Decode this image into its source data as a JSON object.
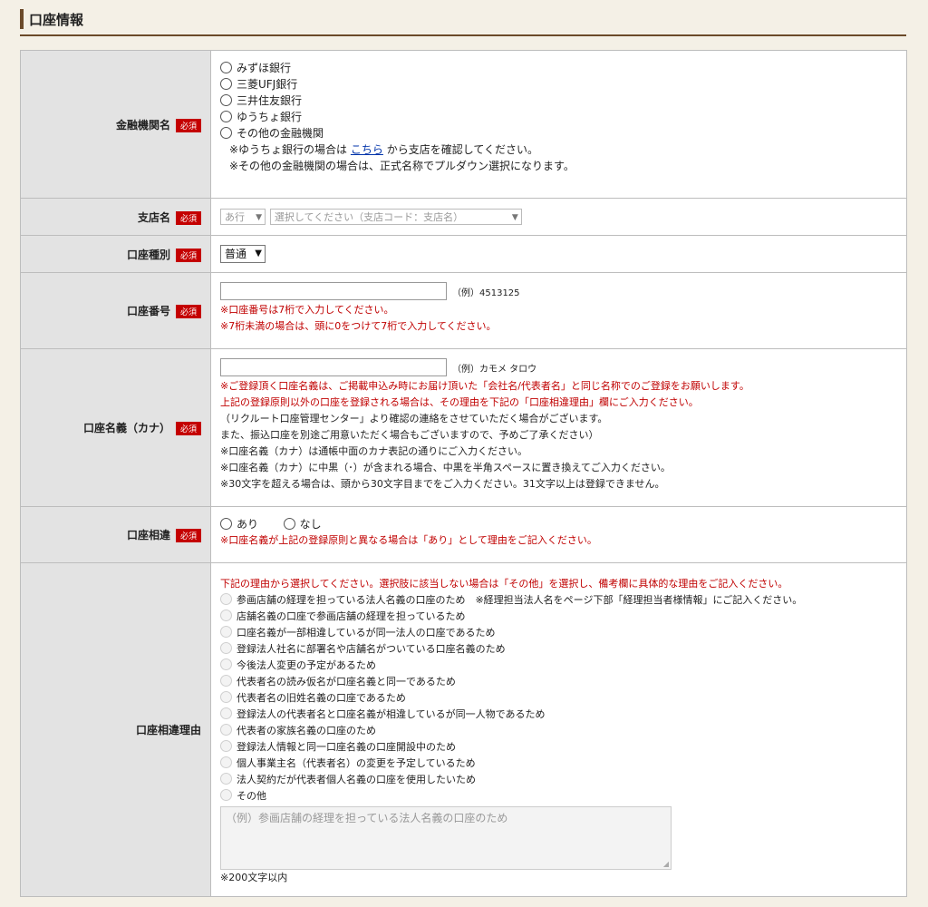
{
  "section": {
    "title": "口座情報"
  },
  "required_badge": "必須",
  "bank": {
    "label": "金融機関名",
    "options": [
      "みずほ銀行",
      "三菱UFJ銀行",
      "三井住友銀行",
      "ゆうちょ銀行",
      "その他の金融機関"
    ],
    "note1_prefix": "※ゆうちょ銀行の場合は",
    "note1_link": "こちら",
    "note1_suffix": "から支店を確認してください。",
    "note2": "※その他の金融機関の場合は、正式名称でプルダウン選択になります。"
  },
  "branch": {
    "label": "支店名",
    "kana_value": "あ行",
    "branch_placeholder": "選択してください（支店コード：支店名）"
  },
  "account_type": {
    "label": "口座種別",
    "value": "普通"
  },
  "account_number": {
    "label": "口座番号",
    "example": "（例）4513125",
    "note1": "※口座番号は7桁で入力してください。",
    "note2": "※7桁未満の場合は、頭に0をつけて7桁で入力してください。"
  },
  "account_name": {
    "label": "口座名義（カナ）",
    "example": "（例）カモメ タロウ",
    "notes_red": [
      "※ご登録頂く口座名義は、ご掲載申込み時にお届け頂いた「会社名/代表者名」と同じ名称でのご登録をお願いします。",
      "上記の登録原則以外の口座を登録される場合は、その理由を下記の「口座相違理由」欄にご入力ください。"
    ],
    "notes_black": [
      "（リクルート口座管理センター」より確認の連絡をさせていただく場合がございます。",
      "また、振込口座を別途ご用意いただく場合もございますので、予めご了承ください）",
      "※口座名義（カナ）は通帳中面のカナ表記の通りにご入力ください。",
      "※口座名義（カナ）に中黒（･）が含まれる場合、中黒を半角スペースに置き換えてご入力ください。",
      "※30文字を超える場合は、頭から30文字目までをご入力ください。31文字以上は登録できません。"
    ]
  },
  "account_diff": {
    "label": "口座相違",
    "yes": "あり",
    "no": "なし",
    "note": "※口座名義が上記の登録原則と異なる場合は「あり」として理由をご記入ください。"
  },
  "diff_reason": {
    "label": "口座相違理由",
    "instruction": "下記の理由から選択してください。選択肢に該当しない場合は「その他」を選択し、備考欄に具体的な理由をご記入ください。",
    "options": [
      "参画店舗の経理を担っている法人名義の口座のため　※経理担当法人名をページ下部「経理担当者様情報」にご記入ください。",
      "店舗名義の口座で参画店舗の経理を担っているため",
      "口座名義が一部相違しているが同一法人の口座であるため",
      "登録法人社名に部署名や店舗名がついている口座名義のため",
      "今後法人変更の予定があるため",
      "代表者名の読み仮名が口座名義と同一であるため",
      "代表者名の旧姓名義の口座であるため",
      "登録法人の代表者名と口座名義が相違しているが同一人物であるため",
      "代表者の家族名義の口座のため",
      "登録法人情報と同一口座名義の口座開設中のため",
      "個人事業主名（代表者名）の変更を予定しているため",
      "法人契約だが代表者個人名義の口座を使用したいため",
      "その他"
    ],
    "textarea_placeholder": "（例）参画店舗の経理を担っている法人名義の口座のため",
    "limit_note": "※200文字以内"
  }
}
